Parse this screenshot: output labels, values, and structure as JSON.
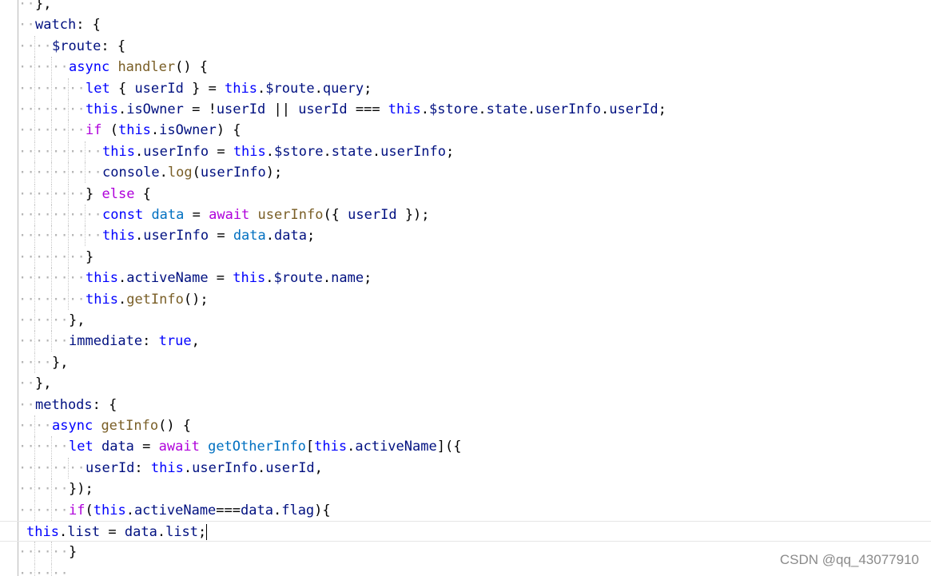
{
  "editor": {
    "lines": [
      {
        "indent": 1,
        "tokens": [
          [
            "plain",
            "},"
          ]
        ]
      },
      {
        "indent": 1,
        "tokens": [
          [
            "var",
            "watch"
          ],
          [
            "plain",
            ": {"
          ]
        ]
      },
      {
        "indent": 2,
        "tokens": [
          [
            "var",
            "$route"
          ],
          [
            "plain",
            ": {"
          ]
        ]
      },
      {
        "indent": 3,
        "tokens": [
          [
            "blue",
            "async"
          ],
          [
            "plain",
            " "
          ],
          [
            "fn",
            "handler"
          ],
          [
            "plain",
            "() {"
          ]
        ]
      },
      {
        "indent": 4,
        "tokens": [
          [
            "blue",
            "let"
          ],
          [
            "plain",
            " { "
          ],
          [
            "var",
            "userId"
          ],
          [
            "plain",
            " } = "
          ],
          [
            "blue",
            "this"
          ],
          [
            "plain",
            "."
          ],
          [
            "var",
            "$route"
          ],
          [
            "plain",
            "."
          ],
          [
            "var",
            "query"
          ],
          [
            "plain",
            ";"
          ]
        ]
      },
      {
        "indent": 4,
        "tokens": [
          [
            "blue",
            "this"
          ],
          [
            "plain",
            "."
          ],
          [
            "var",
            "isOwner"
          ],
          [
            "plain",
            " = !"
          ],
          [
            "var",
            "userId"
          ],
          [
            "plain",
            " || "
          ],
          [
            "var",
            "userId"
          ],
          [
            "plain",
            " === "
          ],
          [
            "blue",
            "this"
          ],
          [
            "plain",
            "."
          ],
          [
            "var",
            "$store"
          ],
          [
            "plain",
            "."
          ],
          [
            "var",
            "state"
          ],
          [
            "plain",
            "."
          ],
          [
            "var",
            "userInfo"
          ],
          [
            "plain",
            "."
          ],
          [
            "var",
            "userId"
          ],
          [
            "plain",
            ";"
          ]
        ]
      },
      {
        "indent": 4,
        "tokens": [
          [
            "kw",
            "if"
          ],
          [
            "plain",
            " ("
          ],
          [
            "blue",
            "this"
          ],
          [
            "plain",
            "."
          ],
          [
            "var",
            "isOwner"
          ],
          [
            "plain",
            ") {"
          ]
        ]
      },
      {
        "indent": 5,
        "tokens": [
          [
            "blue",
            "this"
          ],
          [
            "plain",
            "."
          ],
          [
            "var",
            "userInfo"
          ],
          [
            "plain",
            " = "
          ],
          [
            "blue",
            "this"
          ],
          [
            "plain",
            "."
          ],
          [
            "var",
            "$store"
          ],
          [
            "plain",
            "."
          ],
          [
            "var",
            "state"
          ],
          [
            "plain",
            "."
          ],
          [
            "var",
            "userInfo"
          ],
          [
            "plain",
            ";"
          ]
        ]
      },
      {
        "indent": 5,
        "tokens": [
          [
            "var",
            "console"
          ],
          [
            "plain",
            "."
          ],
          [
            "fn",
            "log"
          ],
          [
            "plain",
            "("
          ],
          [
            "var",
            "userInfo"
          ],
          [
            "plain",
            ");"
          ]
        ]
      },
      {
        "indent": 4,
        "tokens": [
          [
            "plain",
            "} "
          ],
          [
            "kw",
            "else"
          ],
          [
            "plain",
            " {"
          ]
        ]
      },
      {
        "indent": 5,
        "tokens": [
          [
            "blue",
            "const"
          ],
          [
            "plain",
            " "
          ],
          [
            "obj",
            "data"
          ],
          [
            "plain",
            " = "
          ],
          [
            "kw",
            "await"
          ],
          [
            "plain",
            " "
          ],
          [
            "fn",
            "userInfo"
          ],
          [
            "plain",
            "({ "
          ],
          [
            "var",
            "userId"
          ],
          [
            "plain",
            " });"
          ]
        ]
      },
      {
        "indent": 5,
        "tokens": [
          [
            "blue",
            "this"
          ],
          [
            "plain",
            "."
          ],
          [
            "var",
            "userInfo"
          ],
          [
            "plain",
            " = "
          ],
          [
            "obj",
            "data"
          ],
          [
            "plain",
            "."
          ],
          [
            "var",
            "data"
          ],
          [
            "plain",
            ";"
          ]
        ]
      },
      {
        "indent": 4,
        "tokens": [
          [
            "plain",
            "}"
          ]
        ]
      },
      {
        "indent": 4,
        "tokens": [
          [
            "blue",
            "this"
          ],
          [
            "plain",
            "."
          ],
          [
            "var",
            "activeName"
          ],
          [
            "plain",
            " = "
          ],
          [
            "blue",
            "this"
          ],
          [
            "plain",
            "."
          ],
          [
            "var",
            "$route"
          ],
          [
            "plain",
            "."
          ],
          [
            "var",
            "name"
          ],
          [
            "plain",
            ";"
          ]
        ]
      },
      {
        "indent": 4,
        "tokens": [
          [
            "blue",
            "this"
          ],
          [
            "plain",
            "."
          ],
          [
            "fn",
            "getInfo"
          ],
          [
            "plain",
            "();"
          ]
        ]
      },
      {
        "indent": 3,
        "tokens": [
          [
            "plain",
            "},"
          ]
        ]
      },
      {
        "indent": 3,
        "tokens": [
          [
            "var",
            "immediate"
          ],
          [
            "plain",
            ": "
          ],
          [
            "blue",
            "true"
          ],
          [
            "plain",
            ","
          ]
        ]
      },
      {
        "indent": 2,
        "tokens": [
          [
            "plain",
            "},"
          ]
        ]
      },
      {
        "indent": 1,
        "tokens": [
          [
            "plain",
            "},"
          ]
        ]
      },
      {
        "indent": 1,
        "tokens": [
          [
            "var",
            "methods"
          ],
          [
            "plain",
            ": {"
          ]
        ]
      },
      {
        "indent": 2,
        "tokens": [
          [
            "blue",
            "async"
          ],
          [
            "plain",
            " "
          ],
          [
            "fn",
            "getInfo"
          ],
          [
            "plain",
            "() {"
          ]
        ]
      },
      {
        "indent": 3,
        "tokens": [
          [
            "blue",
            "let"
          ],
          [
            "plain",
            " "
          ],
          [
            "var",
            "data"
          ],
          [
            "plain",
            " = "
          ],
          [
            "kw",
            "await"
          ],
          [
            "plain",
            " "
          ],
          [
            "obj",
            "getOtherInfo"
          ],
          [
            "plain",
            "["
          ],
          [
            "blue",
            "this"
          ],
          [
            "plain",
            "."
          ],
          [
            "var",
            "activeName"
          ],
          [
            "plain",
            "]({"
          ]
        ]
      },
      {
        "indent": 4,
        "tokens": [
          [
            "var",
            "userId"
          ],
          [
            "plain",
            ": "
          ],
          [
            "blue",
            "this"
          ],
          [
            "plain",
            "."
          ],
          [
            "var",
            "userInfo"
          ],
          [
            "plain",
            "."
          ],
          [
            "var",
            "userId"
          ],
          [
            "plain",
            ","
          ]
        ]
      },
      {
        "indent": 3,
        "tokens": [
          [
            "plain",
            "});"
          ]
        ]
      },
      {
        "indent": 3,
        "tokens": [
          [
            "kw",
            "if"
          ],
          [
            "plain",
            "("
          ],
          [
            "blue",
            "this"
          ],
          [
            "plain",
            "."
          ],
          [
            "var",
            "activeName"
          ],
          [
            "plain",
            "==="
          ],
          [
            "var",
            "data"
          ],
          [
            "plain",
            "."
          ],
          [
            "var",
            "flag"
          ],
          [
            "plain",
            "){"
          ]
        ]
      },
      {
        "indent": 0,
        "active": true,
        "tokens": [
          [
            "blue",
            "this"
          ],
          [
            "plain",
            "."
          ],
          [
            "var",
            "list"
          ],
          [
            "plain",
            " = "
          ],
          [
            "var",
            "data"
          ],
          [
            "plain",
            "."
          ],
          [
            "var",
            "list"
          ],
          [
            "plain",
            ";"
          ]
        ]
      },
      {
        "indent": 3,
        "tokens": [
          [
            "plain",
            "}"
          ]
        ]
      },
      {
        "indent": 3,
        "tokens": []
      }
    ]
  },
  "watermark": "CSDN @qq_43077910"
}
